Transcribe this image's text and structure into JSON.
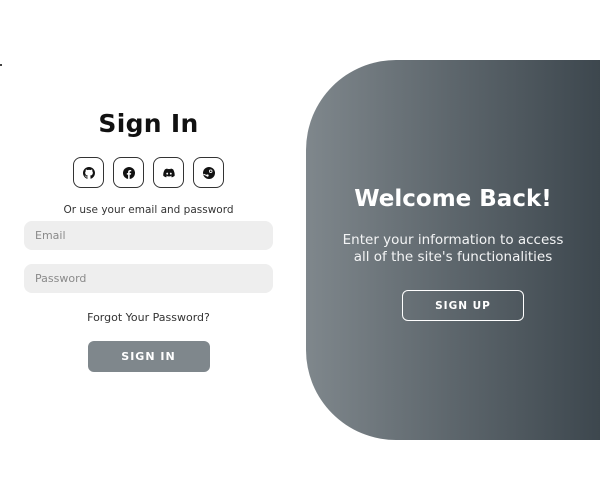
{
  "sign_in": {
    "title": "Sign In",
    "socials": [
      {
        "name": "github",
        "icon": "github-icon"
      },
      {
        "name": "facebook",
        "icon": "facebook-icon"
      },
      {
        "name": "discord",
        "icon": "discord-icon"
      },
      {
        "name": "steam",
        "icon": "steam-icon"
      }
    ],
    "alt_text": "Or use your email and password",
    "email_placeholder": "Email",
    "email_value": "",
    "password_placeholder": "Password",
    "password_value": "",
    "forgot_label": "Forgot Your Password?",
    "submit_label": "SIGN IN"
  },
  "welcome_panel": {
    "title": "Welcome Back!",
    "line1": "Enter your information to access",
    "line2": "all of the site's functionalities",
    "signup_label": "SIGN UP"
  },
  "colors": {
    "panel_gradient_start": "#7f878c",
    "panel_gradient_end": "#3d474e",
    "signin_button": "#7f878c",
    "field_background": "#eeeeee"
  }
}
